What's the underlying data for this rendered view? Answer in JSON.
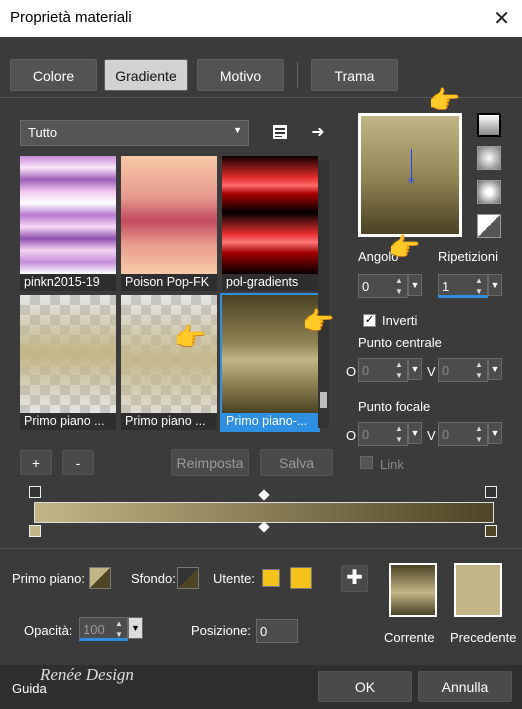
{
  "window": {
    "title": "Proprietà materiali",
    "close": "✕"
  },
  "tabs": [
    "Colore",
    "Gradiente",
    "Motivo",
    "Trama"
  ],
  "filter": {
    "value": "Tutto"
  },
  "gradients": [
    {
      "name": "pinkn2015-19"
    },
    {
      "name": "Poison Pop-FK"
    },
    {
      "name": "pol-gradients"
    },
    {
      "name": "Primo piano ..."
    },
    {
      "name": "Primo piano ..."
    },
    {
      "name": "Primo piano-..."
    }
  ],
  "buttons": {
    "add": "+",
    "remove": "-",
    "reset": "Reimposta",
    "save": "Salva",
    "ok": "OK",
    "cancel": "Annulla",
    "guide": "Guida"
  },
  "angle": {
    "label": "Angolo",
    "value": "0"
  },
  "repeats": {
    "label": "Ripetizioni",
    "value": "1"
  },
  "invert": {
    "label": "Inverti",
    "checked": true
  },
  "center": {
    "label": "Punto centrale",
    "h_label": "O",
    "h": "0",
    "v_label": "V",
    "v": "0"
  },
  "focal": {
    "label": "Punto focale",
    "h_label": "O",
    "h": "0",
    "v_label": "V",
    "v": "0"
  },
  "link": {
    "label": "Link"
  },
  "bottom": {
    "fg_label": "Primo piano:",
    "bg_label": "Sfondo:",
    "user_label": "Utente:",
    "opacity_label": "Opacità:",
    "opacity": "100",
    "position_label": "Posizione:",
    "position": "0",
    "current": "Corrente",
    "previous": "Precedente"
  },
  "watermark": "Renée Design",
  "colors": {
    "accent": "#2f8fe0",
    "gradient_start": "#c3b686",
    "gradient_end": "#4e4525",
    "user": "#f5c21b"
  }
}
